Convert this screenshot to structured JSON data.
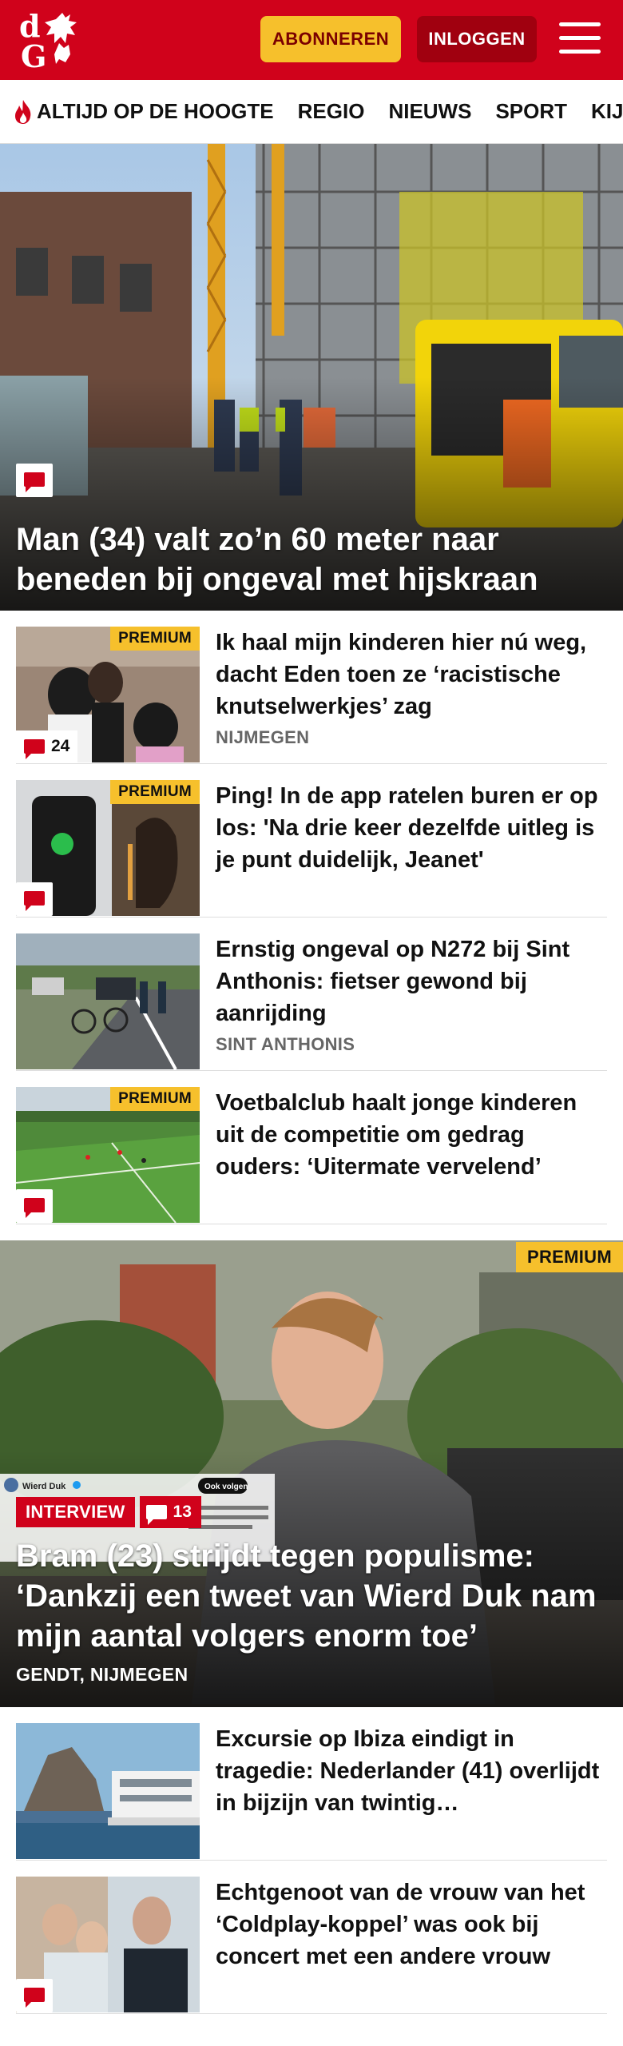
{
  "header": {
    "logo_text": "dG",
    "subscribe_label": "ABONNEREN",
    "login_label": "INLOGGEN",
    "menu_icon": "hamburger-icon"
  },
  "nav": {
    "items": [
      "ALTIJD OP DE HOOGTE",
      "REGIO",
      "NIEUWS",
      "SPORT",
      "KIJK"
    ],
    "first_icon": "flame-icon"
  },
  "hero": {
    "title": "Man (34) valt zo’n 60 meter naar beneden bij ongeval met hijskraan",
    "comment_icon": "comment-icon"
  },
  "articles": [
    {
      "title": "Ik haal mijn kinderen hier nú weg, dacht Eden toen ze ‘racistische knutselwerkjes’ zag",
      "location": "NIJMEGEN",
      "premium": "PREMIUM",
      "comments": "24"
    },
    {
      "title": "Ping! In de app ratelen buren er op los: 'Na drie keer dezelfde uitleg is je punt duidelijk, Jeanet'",
      "location": "",
      "premium": "PREMIUM",
      "comments": ""
    },
    {
      "title": "Ernstig ongeval op N272 bij Sint Anthonis: fietser gewond bij aanrijding",
      "location": "SINT ANTHONIS",
      "premium": "",
      "comments": ""
    },
    {
      "title": "Voetbalclub haalt jonge kinderen uit de competitie om gedrag ouders: ‘Uitermate vervelend’",
      "location": "",
      "premium": "PREMIUM",
      "comments": ""
    }
  ],
  "feature": {
    "premium": "PREMIUM",
    "tag": "INTERVIEW",
    "comments": "13",
    "title": "Bram (23) strijdt tegen populisme: ‘Dankzij een tweet van Wierd Duk nam mijn aantal volgers enorm toe’",
    "location": "GENDT, NIJMEGEN",
    "tweet_author": "Wierd Duk",
    "tweet_button": "Ook volgen"
  },
  "articles2": [
    {
      "title": "Excursie op Ibiza eindigt in tragedie: Nederlander (41) overlijdt in bijzijn van twintig…",
      "location": "",
      "premium": "",
      "comments": ""
    },
    {
      "title": "Echtgenoot van de vrouw van het ‘Coldplay-koppel’ was ook bij concert met een andere vrouw",
      "location": "",
      "premium": "",
      "comments": ""
    }
  ],
  "colors": {
    "brand_red": "#d0021b",
    "premium_yellow": "#f6c02c",
    "login_dark_red": "#a0000f"
  }
}
